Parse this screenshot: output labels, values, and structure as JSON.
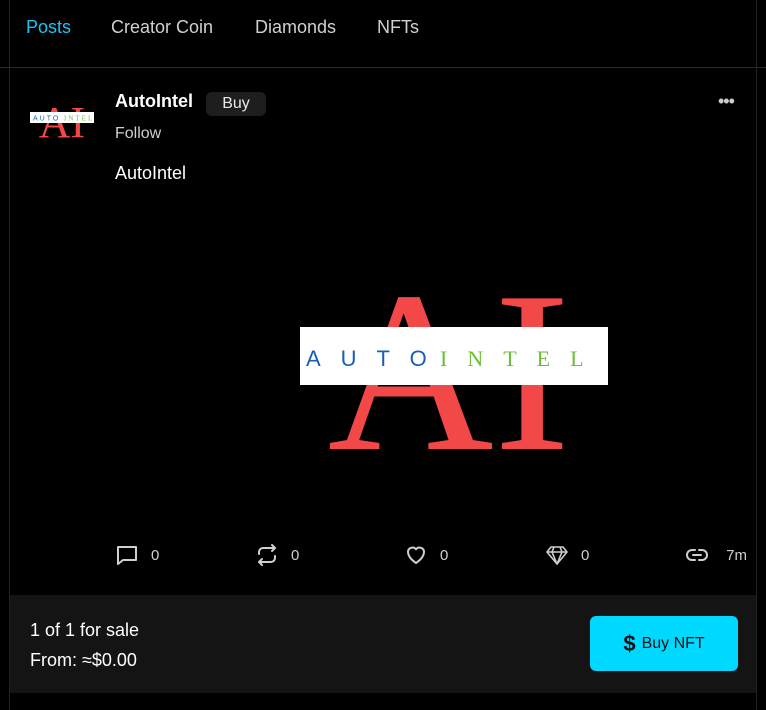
{
  "tabs": [
    {
      "label": "Posts",
      "active": true
    },
    {
      "label": "Creator Coin",
      "active": false
    },
    {
      "label": "Diamonds",
      "active": false
    },
    {
      "label": "NFTs",
      "active": false
    }
  ],
  "post": {
    "username": "AutoIntel",
    "buy_label": "Buy",
    "follow_label": "Follow",
    "more_icon": "ellipsis-icon",
    "text": "AutoIntel",
    "logo": {
      "big_letters": "AI",
      "word_left": "AUTO",
      "word_right": "INTEL",
      "red_color": "#f24848",
      "blue_color": "#1a5fb4",
      "green_color": "#6bbf3a"
    },
    "actions": {
      "comments": "0",
      "reposts": "0",
      "likes": "0",
      "diamonds": "0",
      "time": "7m"
    }
  },
  "sale": {
    "count_text": "1 of 1 for sale",
    "price_text": "From: ≈$0.00",
    "buy_button_label": "Buy NFT",
    "buy_button_icon": "$",
    "accent_color": "#00d9ff"
  }
}
